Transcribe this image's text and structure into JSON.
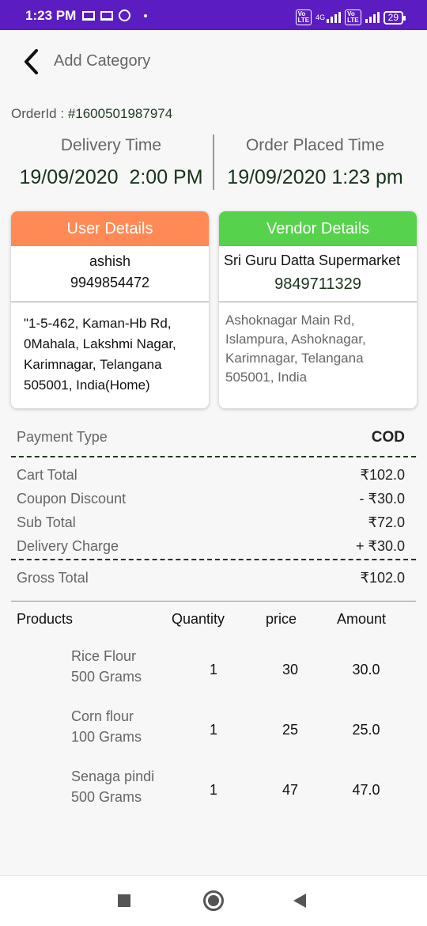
{
  "status_bar": {
    "time": "1:23 PM",
    "battery": "29",
    "network": "4G",
    "volte": "Vo LTE"
  },
  "header": {
    "title": "Add Category"
  },
  "order": {
    "id_label": "OrderId : ",
    "id_value": "#1600501987974"
  },
  "times": {
    "delivery_label": "Delivery Time",
    "delivery_value": "19/09/2020  2:00 PM",
    "placed_label": "Order Placed Time",
    "placed_value": "19/09/2020 1:23 pm"
  },
  "user": {
    "title": "User Details",
    "name": "ashish",
    "phone": "9949854472",
    "address": "\"1-5-462, Kaman-Hb Rd, 0Mahala, Lakshmi Nagar, Karimnagar, Telangana 505001, India(Home)"
  },
  "vendor": {
    "title": "Vendor Details",
    "name": "Sri Guru Datta Supermarket",
    "phone": "9849711329",
    "address": "Ashoknagar Main Rd, Islampura, Ashoknagar, Karimnagar, Telangana 505001, India"
  },
  "payment": {
    "label": "Payment Type",
    "value": "COD"
  },
  "summary": {
    "cart_total_label": "Cart Total",
    "cart_total": "₹102.0",
    "coupon_label": "Coupon Discount",
    "coupon": "- ₹30.0",
    "sub_total_label": "Sub Total",
    "sub_total": "₹72.0",
    "delivery_label": "Delivery Charge",
    "delivery": "+ ₹30.0",
    "gross_label": "Gross Total",
    "gross": "₹102.0"
  },
  "table": {
    "headers": [
      "Products",
      "Quantity",
      "price",
      "Amount"
    ],
    "rows": [
      {
        "name": "Rice Flour",
        "unit": "500 Grams",
        "qty": "1",
        "price": "30",
        "amount": "30.0"
      },
      {
        "name": "Corn flour",
        "unit": "100 Grams",
        "qty": "1",
        "price": "25",
        "amount": "25.0"
      },
      {
        "name": "Senaga pindi",
        "unit": "500 Grams",
        "qty": "1",
        "price": "47",
        "amount": "47.0"
      }
    ]
  },
  "icons": {
    "back": "chevron-left-icon",
    "nav_recents": "square-icon",
    "nav_home": "circle-icon",
    "nav_back": "triangle-back-icon"
  },
  "colors": {
    "status_bar": "#5b1dc1",
    "user_header": "#ff8a55",
    "vendor_header": "#57d24c",
    "cod": "#5acc3a",
    "dark_green_text": "#18331a"
  }
}
